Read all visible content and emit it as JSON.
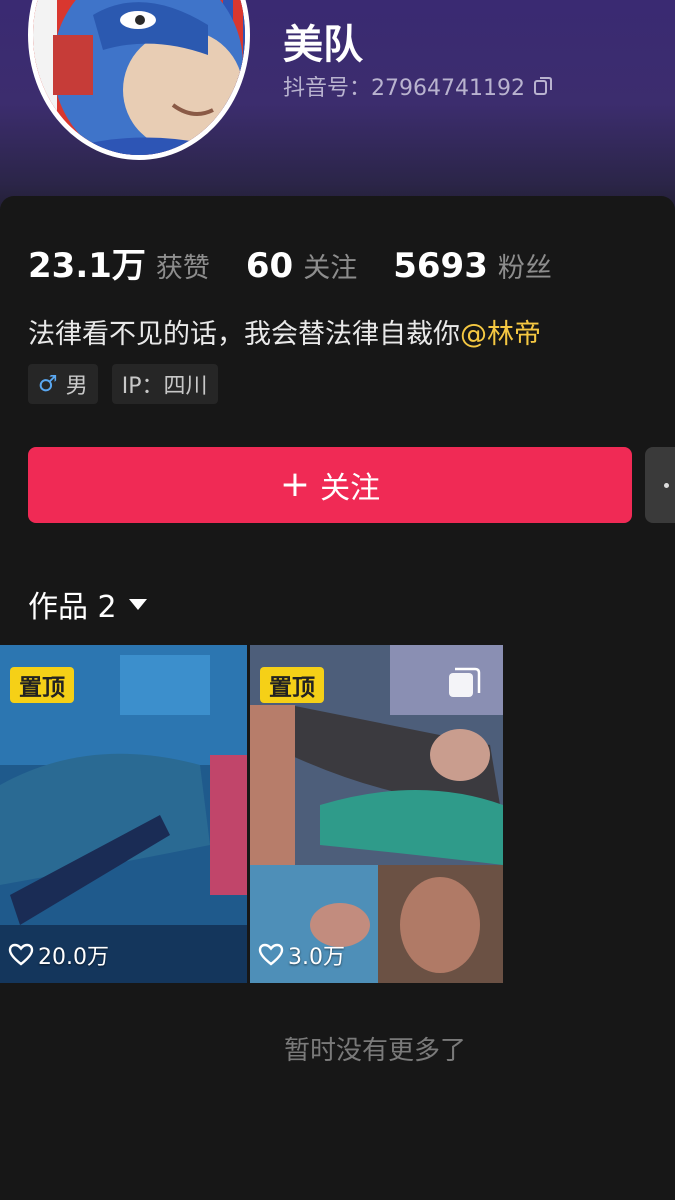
{
  "profile": {
    "username": "美队",
    "douyin_id": "抖音号：27964741192"
  },
  "stats": [
    {
      "value": "23.1万",
      "label": "获赞"
    },
    {
      "value": "60",
      "label": "关注"
    },
    {
      "value": "5693",
      "label": "粉丝"
    }
  ],
  "bio": {
    "text": "法律看不见的话，我会替法律自裁你",
    "mention": "@林帝"
  },
  "tags": {
    "gender": "男",
    "ip": "IP：四川"
  },
  "actions": {
    "follow_label": "关注"
  },
  "works": {
    "title": "作品 2",
    "items": [
      {
        "badge": "置顶",
        "likes": "20.0万"
      },
      {
        "badge": "置顶",
        "likes": "3.0万"
      }
    ],
    "end_text": "暂时没有更多了"
  },
  "colors": {
    "follow_button": "#f02a55",
    "mention": "#f5c842",
    "pin_badge": "#f5d017",
    "header_top": "#3a2a72"
  }
}
